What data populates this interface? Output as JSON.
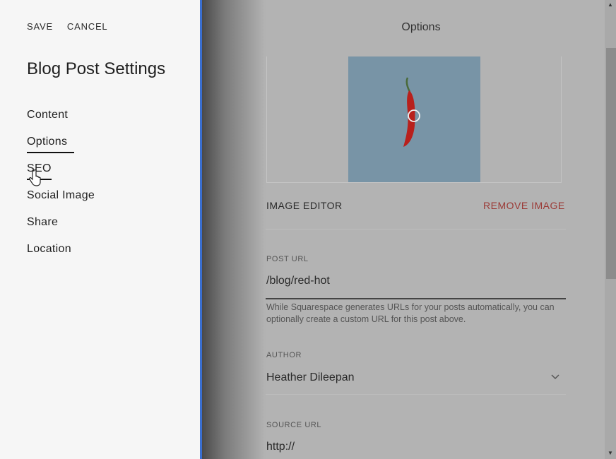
{
  "panel": {
    "save": "SAVE",
    "cancel": "CANCEL",
    "title": "Blog Post Settings",
    "nav": [
      "Content",
      "Options",
      "SEO",
      "Social Image",
      "Share",
      "Location"
    ]
  },
  "options": {
    "title": "Options",
    "image_editor": "IMAGE EDITOR",
    "remove_image": "REMOVE IMAGE",
    "post_url_label": "POST URL",
    "post_url_value": "/blog/red-hot",
    "post_url_help": "While Squarespace generates URLs for your posts automatically, you can optionally create a custom URL for this post above.",
    "author_label": "AUTHOR",
    "author_value": "Heather Dileepan",
    "source_url_label": "SOURCE URL",
    "source_url_value": "http://"
  },
  "colors": {
    "accent": "#3a6fd0",
    "remove": "#9b3a36"
  }
}
